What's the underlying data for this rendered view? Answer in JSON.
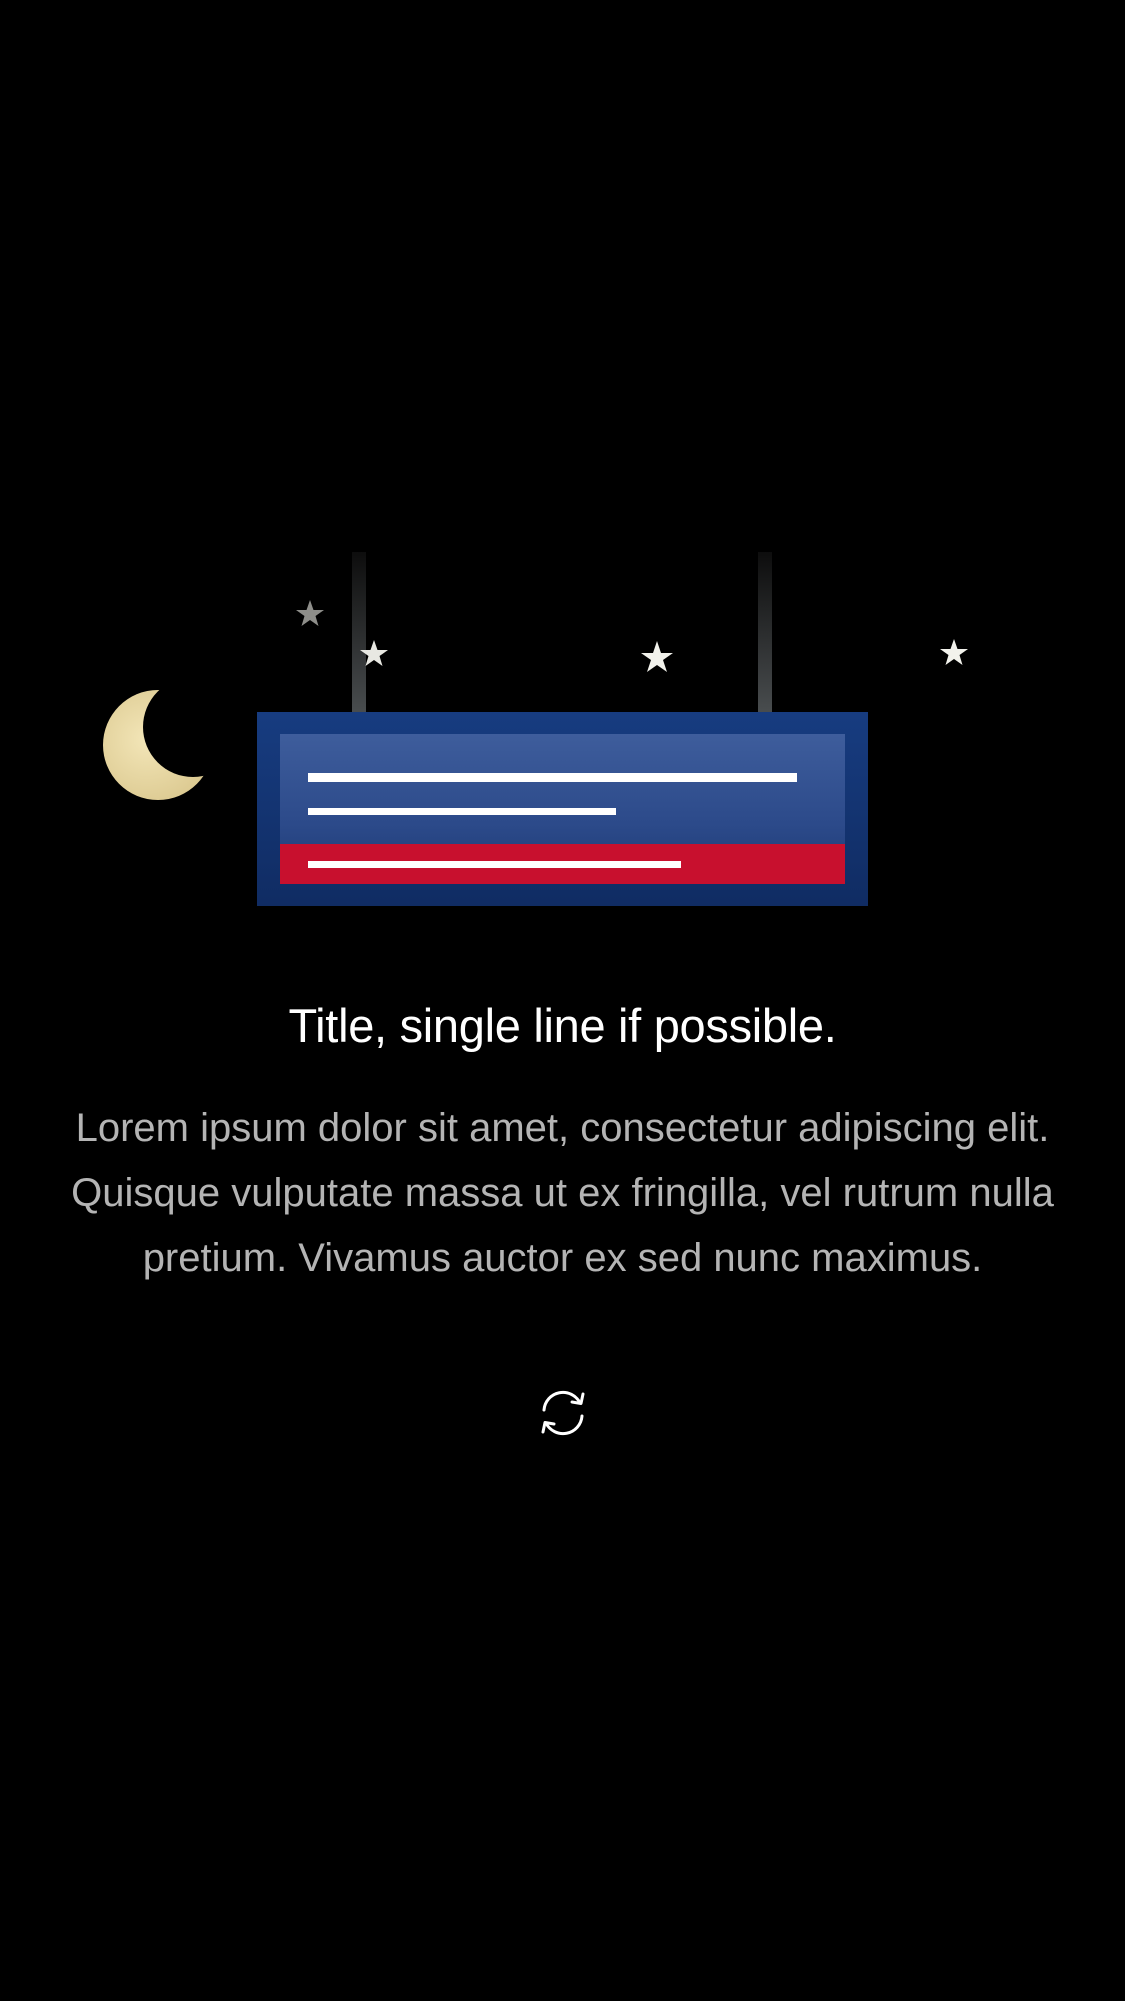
{
  "empty_state": {
    "title": "Title, single line if possible.",
    "body": "Lorem ipsum dolor sit amet, consectetur adipiscing elit. Quisque vulputate massa ut ex fringilla, vel rutrum nulla pretium. Vivamus auctor ex sed nunc maximus."
  },
  "illustration": {
    "icons": [
      "moon-icon",
      "star-icon",
      "hanging-sign"
    ],
    "colors": {
      "background": "#000000",
      "sign_blue": "#163a7c",
      "sign_panel": "#2d4c8e",
      "sign_red": "#c8102e",
      "moon": "#eedfa8",
      "star": "#f2f2ec"
    }
  },
  "actions": {
    "refresh_icon": "refresh-icon"
  }
}
